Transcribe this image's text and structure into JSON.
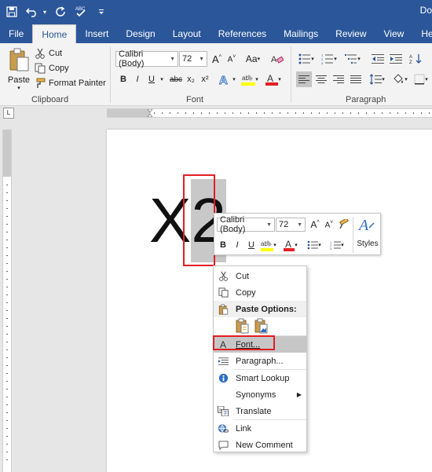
{
  "titlebar": {
    "doc_title": "Do"
  },
  "tabs": [
    {
      "label": "File",
      "active": false
    },
    {
      "label": "Home",
      "active": true
    },
    {
      "label": "Insert",
      "active": false
    },
    {
      "label": "Design",
      "active": false
    },
    {
      "label": "Layout",
      "active": false
    },
    {
      "label": "References",
      "active": false
    },
    {
      "label": "Mailings",
      "active": false
    },
    {
      "label": "Review",
      "active": false
    },
    {
      "label": "View",
      "active": false
    },
    {
      "label": "Help",
      "active": false
    }
  ],
  "clipboard": {
    "paste": "Paste",
    "cut": "Cut",
    "copy": "Copy",
    "format_painter": "Format Painter",
    "label": "Clipboard"
  },
  "font_group": {
    "font_name": "Calibri (Body)",
    "font_size": "72",
    "label": "Font",
    "bold": "B",
    "italic": "I",
    "underline": "U",
    "strike": "abc",
    "sub": "x₂",
    "sup": "x²",
    "aa": "Aa"
  },
  "paragraph_group": {
    "label": "Paragraph"
  },
  "document": {
    "base": "X",
    "selected": "2"
  },
  "mini_toolbar": {
    "font_name": "Calibri (Body)",
    "font_size": "72",
    "styles": "Styles",
    "bold": "B",
    "italic": "I",
    "underline": "U"
  },
  "context_menu": {
    "cut": "Cut",
    "copy": "Copy",
    "paste_options": "Paste Options:",
    "font": "Font...",
    "paragraph": "Paragraph...",
    "smart_lookup": "Smart Lookup",
    "synonyms": "Synonyms",
    "translate": "Translate",
    "link": "Link",
    "new_comment": "New Comment"
  },
  "colors": {
    "accent": "#2b579a",
    "highlight": "#e31e24",
    "selection": "#c8c8c8"
  }
}
